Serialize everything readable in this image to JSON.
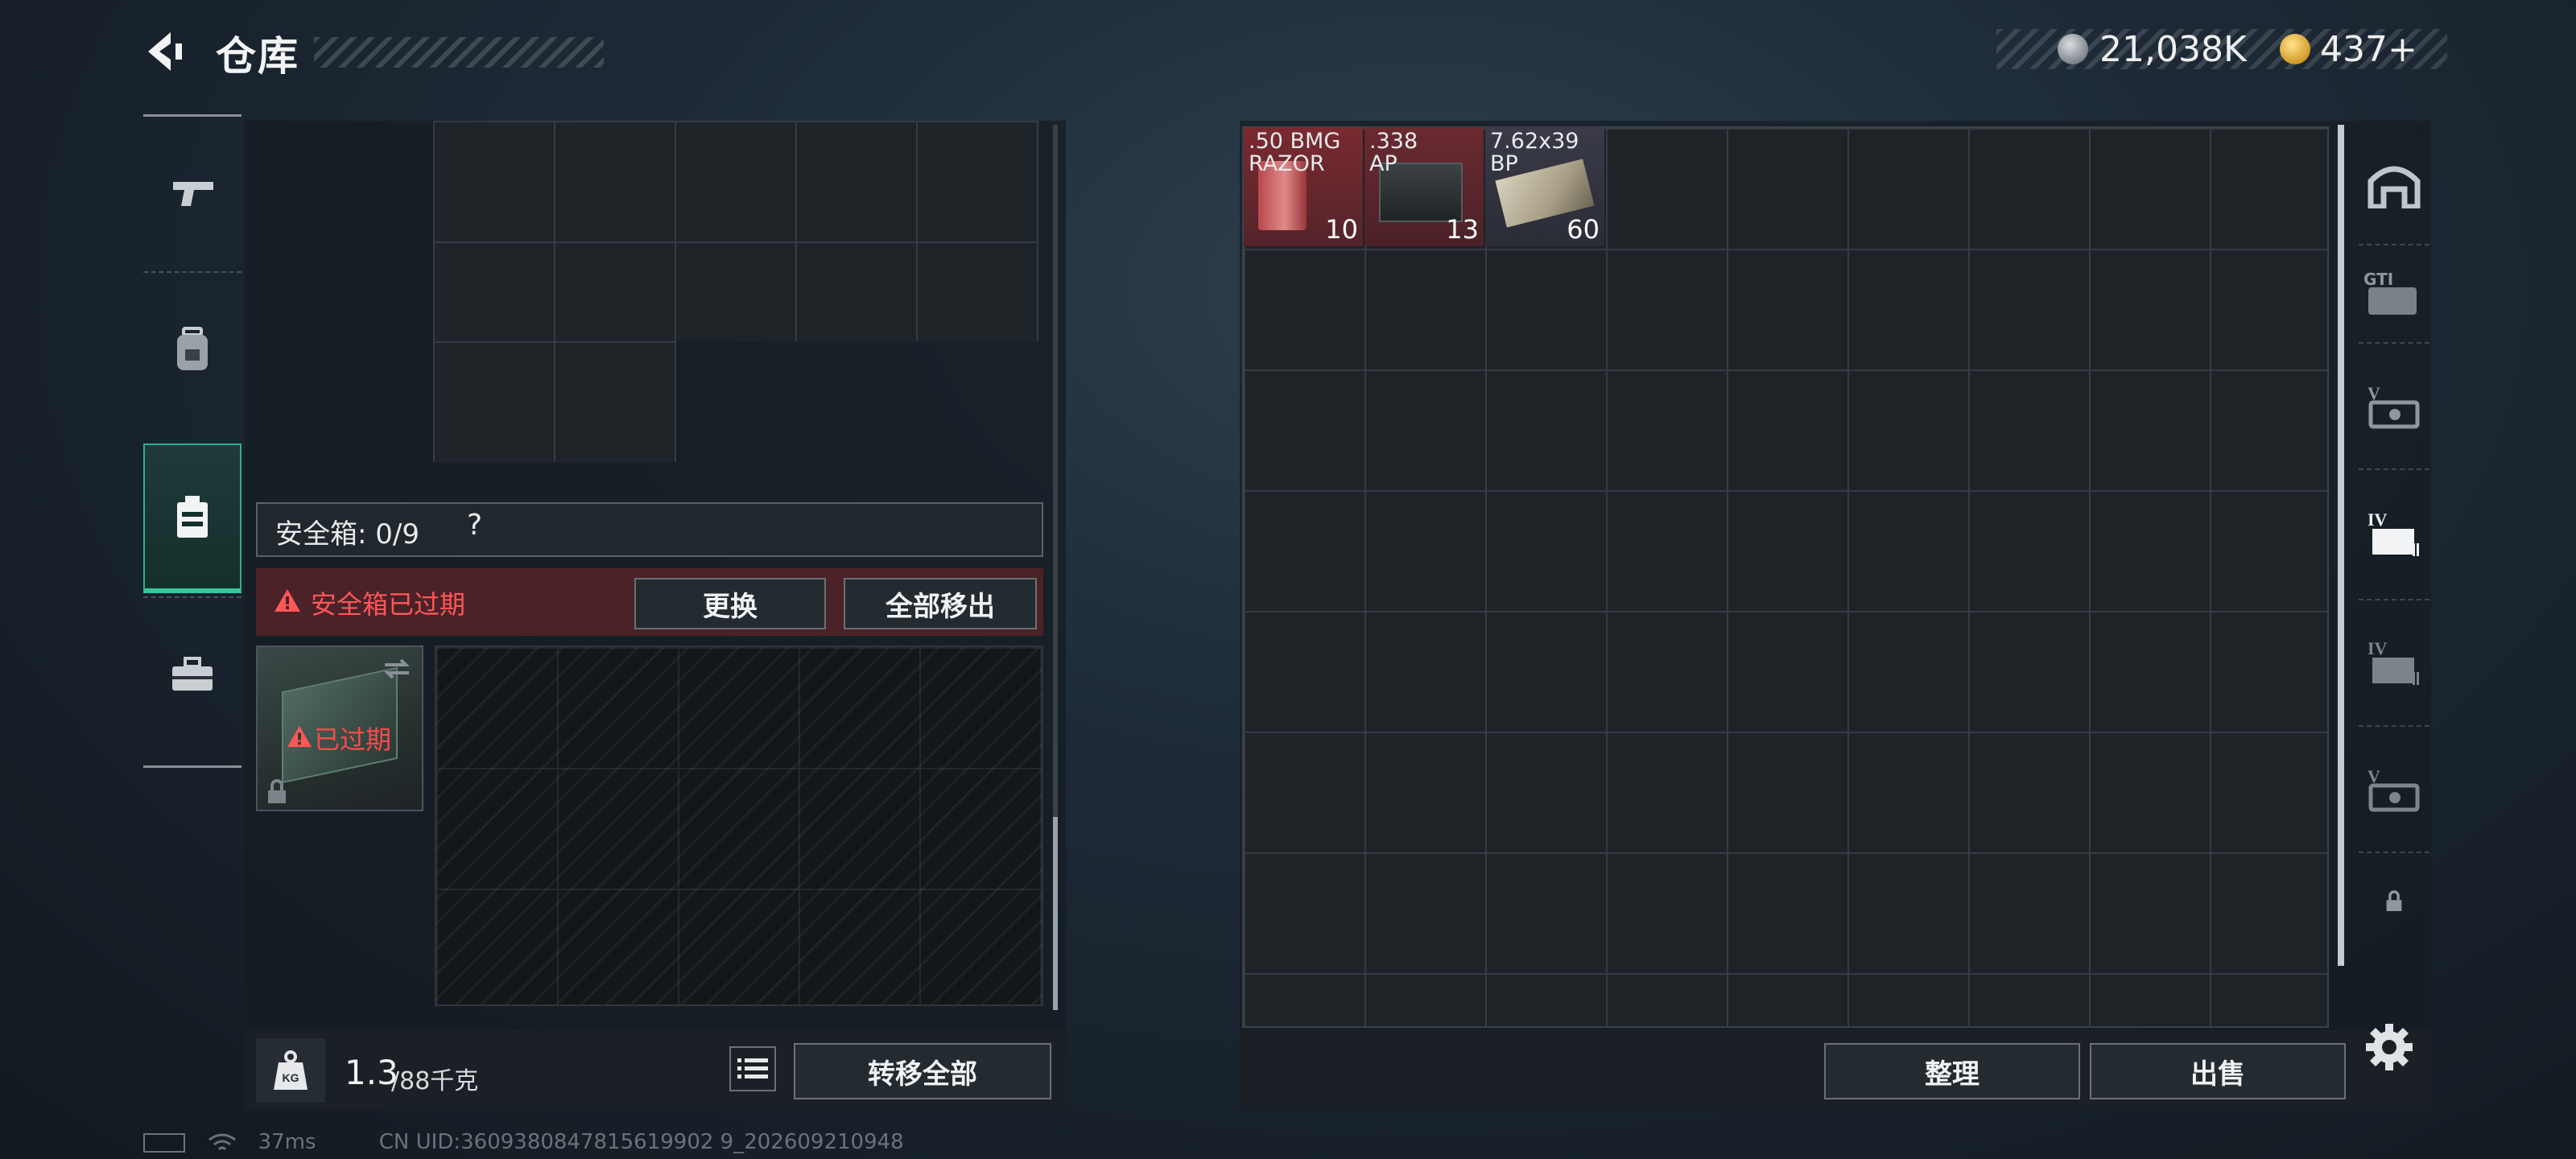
{
  "header": {
    "title": "仓库",
    "currency_primary": "21,038K",
    "currency_secondary": "437+"
  },
  "safebox": {
    "label": "安全箱: 0/9",
    "help": "?",
    "expired_text": "安全箱已过期",
    "replace_button": "更换",
    "remove_all_button": "全部移出",
    "case_status": "已过期"
  },
  "weight": {
    "current": "1.3",
    "max": "/88千克",
    "transfer_all_button": "转移全部"
  },
  "stash": {
    "items": [
      {
        "name": ".50 BMG\nRAZOR",
        "count": "10"
      },
      {
        "name": ".338\nAP",
        "count": "13"
      },
      {
        "name": "7.62x39\nBP",
        "count": "60"
      }
    ],
    "sort_button": "整理",
    "sell_button": "出售"
  },
  "right_nav": {
    "tab1": "GTI"
  },
  "status_bar": {
    "ping": "37ms",
    "uid": "CN UID:3609380847815619902 9_202609210948"
  },
  "colors": {
    "accent_green": "#37c79c",
    "warning_red": "#ff5757",
    "expired_bg": "#4a2228"
  }
}
